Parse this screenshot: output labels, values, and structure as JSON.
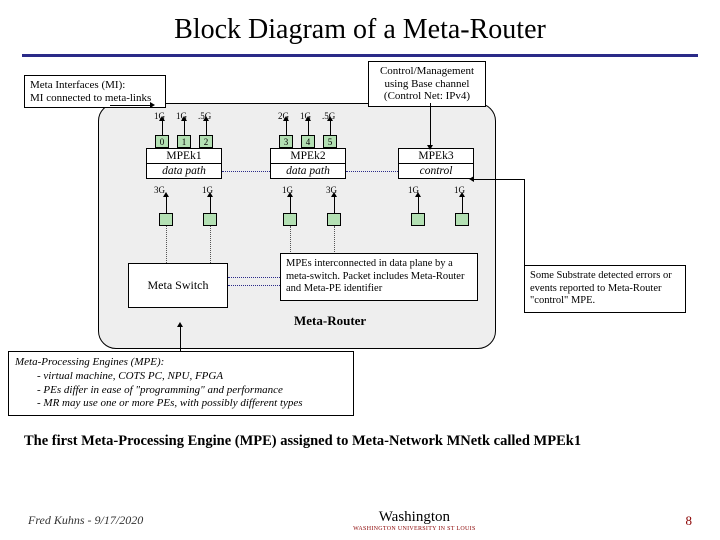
{
  "title": "Block Diagram of a Meta-Router",
  "mi_box": {
    "l1": "Meta Interfaces (MI):",
    "l2": "MI connected to meta-links"
  },
  "cm_box": {
    "l1": "Control/Management",
    "l2": "using Base channel",
    "l3": "(Control Net: IPv4)"
  },
  "ports": {
    "g1": {
      "bw0": "1G",
      "bw1": "1G",
      "bw2": ".5G",
      "p0": "0",
      "p1": "1",
      "p2": "2"
    },
    "g2": {
      "bw3": "2G",
      "bw4": "1G",
      "bw5": ".5G",
      "p3": "3",
      "p4": "4",
      "p5": "5"
    }
  },
  "mpe1": {
    "name": "MPEk1",
    "sub": "data path",
    "bw_l": "3G",
    "bw_r": "1G"
  },
  "mpe2": {
    "name": "MPEk2",
    "sub": "data path",
    "bw_l": "1G",
    "bw_r": "3G"
  },
  "mpe3": {
    "name": "MPEk3",
    "sub": "control",
    "bw_l": "1G",
    "bw_r": "1G"
  },
  "switch": "Meta Switch",
  "mr_label": "Meta-Router",
  "mpe_note": "MPEs interconnected in data plane by a meta-switch. Packet includes Meta-Router and Meta-PE identifier",
  "err_note": "Some Substrate detected errors or events reported to Meta-Router \"control\" MPE.",
  "mpe_desc": {
    "h": "Meta-Processing Engines (MPE):",
    "a": "- virtual machine, COTS PC, NPU, FPGA",
    "b": "- PEs differ in ease of \"programming\" and performance",
    "c": "- MR may use one or more PEs, with possibly different types"
  },
  "caption": "The first Meta-Processing Engine (MPE) assigned to Meta-Network MNetk called MPEk1",
  "footer": {
    "left": "Fred Kuhns - 9/17/2020",
    "uni": "Washington",
    "sub": "WASHINGTON UNIVERSITY IN ST LOUIS",
    "page": "8"
  }
}
